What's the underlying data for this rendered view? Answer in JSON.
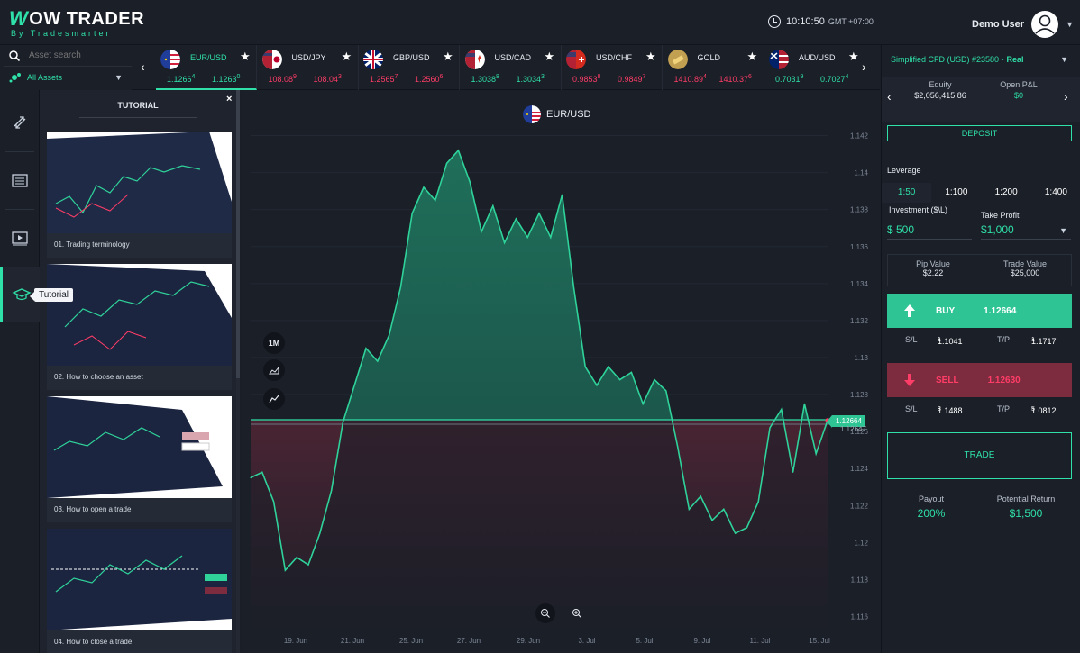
{
  "header": {
    "logo_main": "OW TRADER",
    "logo_sub": "By Tradesmarter",
    "time": "10:10:50",
    "timezone": "GMT +07:00",
    "user_name": "Demo User"
  },
  "search": {
    "placeholder": "Asset search",
    "filter_label": "All Assets"
  },
  "rail": {
    "tooltip": "Tutorial",
    "icons": [
      "swap-icon",
      "news-icon",
      "video-icon",
      "graduation-cap-icon"
    ]
  },
  "tutorial": {
    "title": "TUTORIAL",
    "close": "×",
    "items": [
      {
        "label": "01. Trading terminology"
      },
      {
        "label": "02. How to choose an asset"
      },
      {
        "label": "03. How to open a trade"
      },
      {
        "label": "04. How to close a trade"
      }
    ]
  },
  "instruments": [
    {
      "symbol": "EUR/USD",
      "sell": "1.1266",
      "sell_sup": "4",
      "buy": "1.1263",
      "buy_sup": "0",
      "sell_dir": "up",
      "buy_dir": "up",
      "flag": "eu-us",
      "active": true
    },
    {
      "symbol": "USD/JPY",
      "sell": "108.08",
      "sell_sup": "9",
      "buy": "108.04",
      "buy_sup": "3",
      "sell_dir": "down",
      "buy_dir": "down",
      "flag": "us-jp"
    },
    {
      "symbol": "GBP/USD",
      "sell": "1.2565",
      "sell_sup": "7",
      "buy": "1.2560",
      "buy_sup": "6",
      "sell_dir": "down",
      "buy_dir": "down",
      "flag": "gb-us"
    },
    {
      "symbol": "USD/CAD",
      "sell": "1.3038",
      "sell_sup": "8",
      "buy": "1.3034",
      "buy_sup": "3",
      "sell_dir": "up",
      "buy_dir": "up",
      "flag": "us-ca"
    },
    {
      "symbol": "USD/CHF",
      "sell": "0.9853",
      "sell_sup": "8",
      "buy": "0.9849",
      "buy_sup": "7",
      "sell_dir": "down",
      "buy_dir": "down",
      "flag": "us-ch"
    },
    {
      "symbol": "GOLD",
      "sell": "1410.89",
      "sell_sup": "4",
      "buy": "1410.37",
      "buy_sup": "6",
      "sell_dir": "down",
      "buy_dir": "down",
      "flag": "gold"
    },
    {
      "symbol": "AUD/USD",
      "sell": "0.7031",
      "sell_sup": "9",
      "buy": "0.7027",
      "buy_sup": "4",
      "sell_dir": "up",
      "buy_dir": "up",
      "flag": "au-us"
    }
  ],
  "chart": {
    "title": "EUR/USD",
    "period_button": "1M",
    "current_price": "1.12664",
    "sell_price": "1.12647",
    "colors": {
      "up": "#2fe0a8",
      "down": "#ff3d67",
      "line": "#2fd39a"
    }
  },
  "chart_data": {
    "type": "area",
    "x_tick_labels": [
      "19. Jun",
      "21. Jun",
      "25. Jun",
      "27. Jun",
      "29. Jun",
      "3. Jul",
      "5. Jul",
      "9. Jul",
      "11. Jul",
      "15. Jul"
    ],
    "y_tick_labels": [
      "1.142",
      "1.14",
      "1.138",
      "1.136",
      "1.134",
      "1.132",
      "1.13",
      "1.128",
      "1.126",
      "1.124",
      "1.122",
      "1.12",
      "1.118",
      "1.116"
    ],
    "ylim": [
      1.116,
      1.142
    ],
    "current_price": 1.12664,
    "x": [
      0,
      2,
      4,
      6,
      8,
      10,
      12,
      14,
      16,
      18,
      20,
      22,
      24,
      26,
      28,
      30,
      32,
      34,
      36,
      38,
      40,
      42,
      44,
      46,
      48,
      50,
      52,
      54,
      56,
      58,
      60,
      62,
      64,
      66,
      68,
      70,
      72,
      74,
      76,
      78,
      80,
      82,
      84,
      86,
      88,
      90,
      92,
      94,
      96,
      98,
      100
    ],
    "y": [
      1.1235,
      1.1238,
      1.1222,
      1.1185,
      1.1192,
      1.1188,
      1.1205,
      1.1228,
      1.1265,
      1.1285,
      1.1305,
      1.1298,
      1.1312,
      1.1338,
      1.1378,
      1.1392,
      1.1385,
      1.1405,
      1.1412,
      1.1395,
      1.1368,
      1.1382,
      1.1362,
      1.1375,
      1.1365,
      1.1378,
      1.1365,
      1.1388,
      1.1338,
      1.1295,
      1.1285,
      1.1295,
      1.1288,
      1.1292,
      1.1275,
      1.1288,
      1.1282,
      1.1252,
      1.1218,
      1.1225,
      1.1212,
      1.1218,
      1.1205,
      1.1208,
      1.1222,
      1.1262,
      1.1272,
      1.1238,
      1.1275,
      1.1248,
      1.1266
    ]
  },
  "account": {
    "name": "Simplified CFD (USD) #23580 -",
    "mode": "Real",
    "equity_label": "Equity",
    "equity_value": "$2,056,415.86",
    "pnl_label": "Open P&L",
    "pnl_value": "$0",
    "deposit_label": "DEPOSIT"
  },
  "trade_panel": {
    "leverage_label": "Leverage",
    "leverage_options": [
      "1:50",
      "1:100",
      "1:200",
      "1:400"
    ],
    "investment_label": "Investment ($\\L)",
    "investment_value": "$ 500",
    "take_profit_label": "Take Profit",
    "take_profit_value": "$1,000",
    "pip_label": "Pip Value",
    "pip_value": "$2.22",
    "trade_value_label": "Trade Value",
    "trade_value": "$25,000",
    "buy_label": "BUY",
    "buy_price": "1.12664",
    "buy_sl_label": "S/L",
    "buy_sl": "1.1041",
    "buy_sl_sup": "1",
    "buy_tp_label": "T/P",
    "buy_tp": "1.1717",
    "buy_tp_sup": "1",
    "sell_label": "SELL",
    "sell_price": "1.12630",
    "sell_sl_label": "S/L",
    "sell_sl": "1.1488",
    "sell_sl_sup": "3",
    "sell_tp_label": "T/P",
    "sell_tp": "1.0812",
    "sell_tp_sup": "5",
    "trade_label": "TRADE",
    "payout_label": "Payout",
    "payout_value": "200%",
    "return_label": "Potential Return",
    "return_value": "$1,500"
  }
}
